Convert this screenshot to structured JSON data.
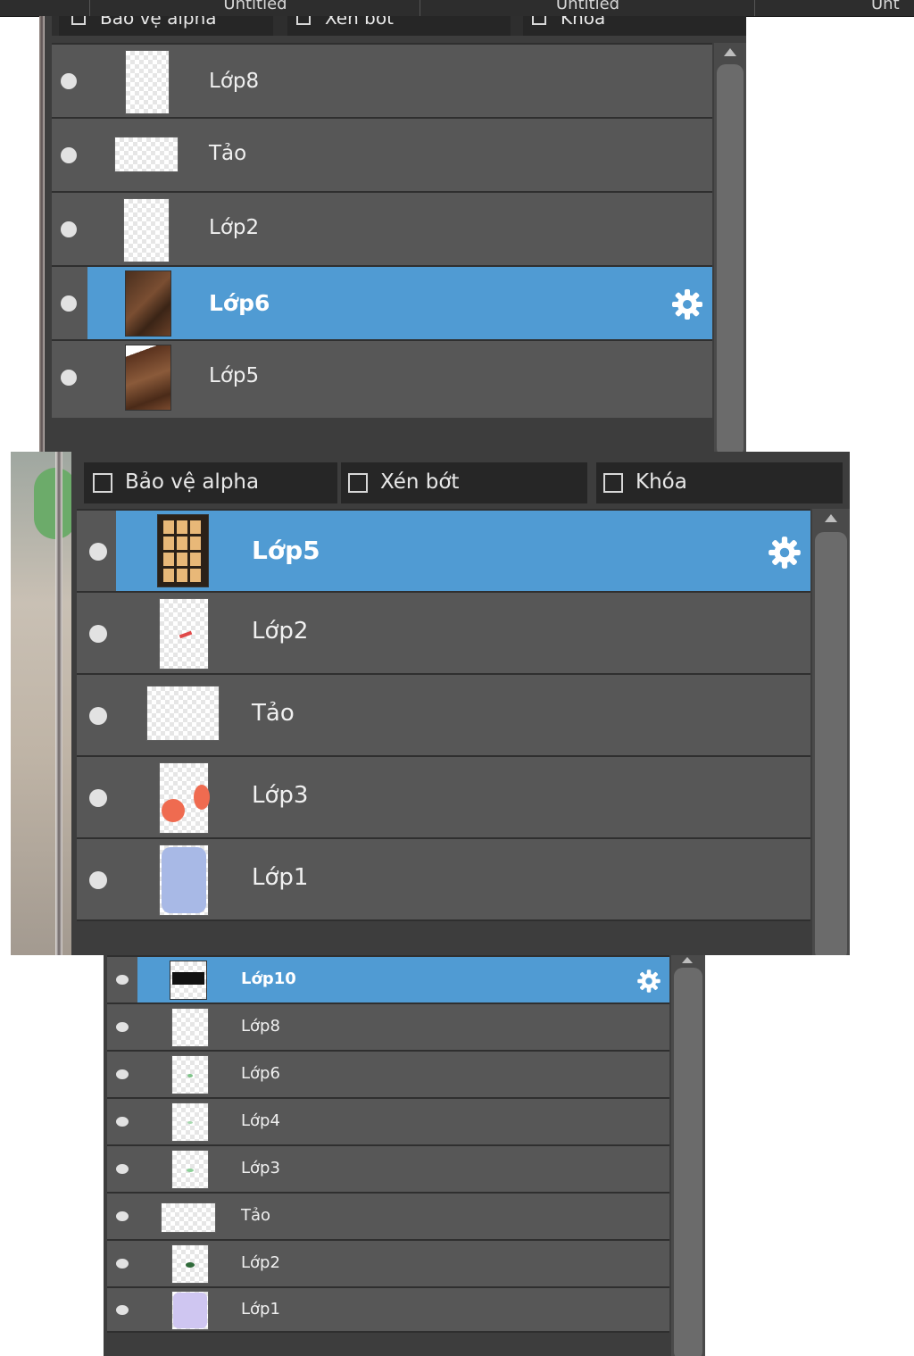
{
  "tabs": [
    "Untitled",
    "Untitled",
    "Unt"
  ],
  "panel1": {
    "checkboxes": [
      "Bảo vệ alpha",
      "Xén bớt",
      "Khóa"
    ],
    "layers": [
      {
        "name": "Lớp8",
        "selected": false
      },
      {
        "name": "Tảo",
        "selected": false
      },
      {
        "name": "Lớp2",
        "selected": false
      },
      {
        "name": "Lớp6",
        "selected": true
      },
      {
        "name": "Lớp5",
        "selected": false
      }
    ]
  },
  "panel2": {
    "checkboxes": [
      "Bảo vệ alpha",
      "Xén bớt",
      "Khóa"
    ],
    "layers": [
      {
        "name": "Lớp5",
        "selected": true
      },
      {
        "name": "Lớp2",
        "selected": false
      },
      {
        "name": "Tảo",
        "selected": false
      },
      {
        "name": "Lớp3",
        "selected": false
      },
      {
        "name": "Lớp1",
        "selected": false
      }
    ]
  },
  "panel3": {
    "layers": [
      {
        "name": "Lớp10",
        "selected": true
      },
      {
        "name": "Lớp8",
        "selected": false
      },
      {
        "name": "Lớp6",
        "selected": false
      },
      {
        "name": "Lớp4",
        "selected": false
      },
      {
        "name": "Lớp3",
        "selected": false
      },
      {
        "name": "Tảo",
        "selected": false
      },
      {
        "name": "Lớp2",
        "selected": false
      },
      {
        "name": "Lớp1",
        "selected": false
      }
    ]
  },
  "icons": {
    "visibility": "eye-dot-icon",
    "settings": "gear-icon",
    "checkbox": "checkbox-icon",
    "scroll_up": "scroll-up-arrow-icon"
  },
  "colors": {
    "selected_row": "#509bd3",
    "row": "#575757",
    "panel_bg": "#3d3d3d",
    "checkbox_bar": "#262626"
  }
}
